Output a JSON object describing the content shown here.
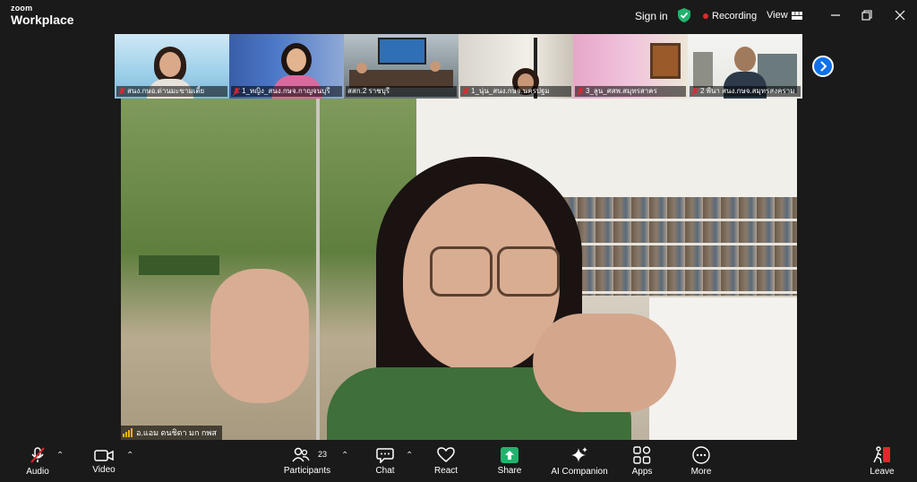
{
  "brand": {
    "line1": "zoom",
    "line2": "Workplace"
  },
  "topbar": {
    "sign_in": "Sign in",
    "recording": "Recording",
    "view": "View",
    "colors": {
      "shield": "#23b26d",
      "recording_dot": "#e0282e"
    }
  },
  "thumbnails": [
    {
      "name": "สนง.กษอ.ด่านมะขามเตี้ย",
      "muted": true
    },
    {
      "name": "1_หญิง_สนง.กษจ.กาญจนบุรี",
      "muted": true
    },
    {
      "name": "สสก.2 ราชบุรี",
      "muted": false
    },
    {
      "name": "1_นุ่น_สนง.กษจ.นครปฐม",
      "muted": true
    },
    {
      "name": "3_ลูน_ศสพ.สมุทรสาคร",
      "muted": true
    },
    {
      "name": "2 พีนา สนง.กษจ.สมุทรสงคราม",
      "muted": true
    }
  ],
  "active_speaker": {
    "name": "อ.แอม ดนชิดา มก กพส"
  },
  "toolbar": {
    "audio": "Audio",
    "video": "Video",
    "participants": "Participants",
    "participants_count": "23",
    "chat": "Chat",
    "react": "React",
    "share": "Share",
    "ai_companion": "AI Companion",
    "apps": "Apps",
    "more": "More",
    "leave": "Leave",
    "colors": {
      "share": "#23b26d",
      "muted": "#e0282e",
      "leave": "#e0282e"
    }
  }
}
